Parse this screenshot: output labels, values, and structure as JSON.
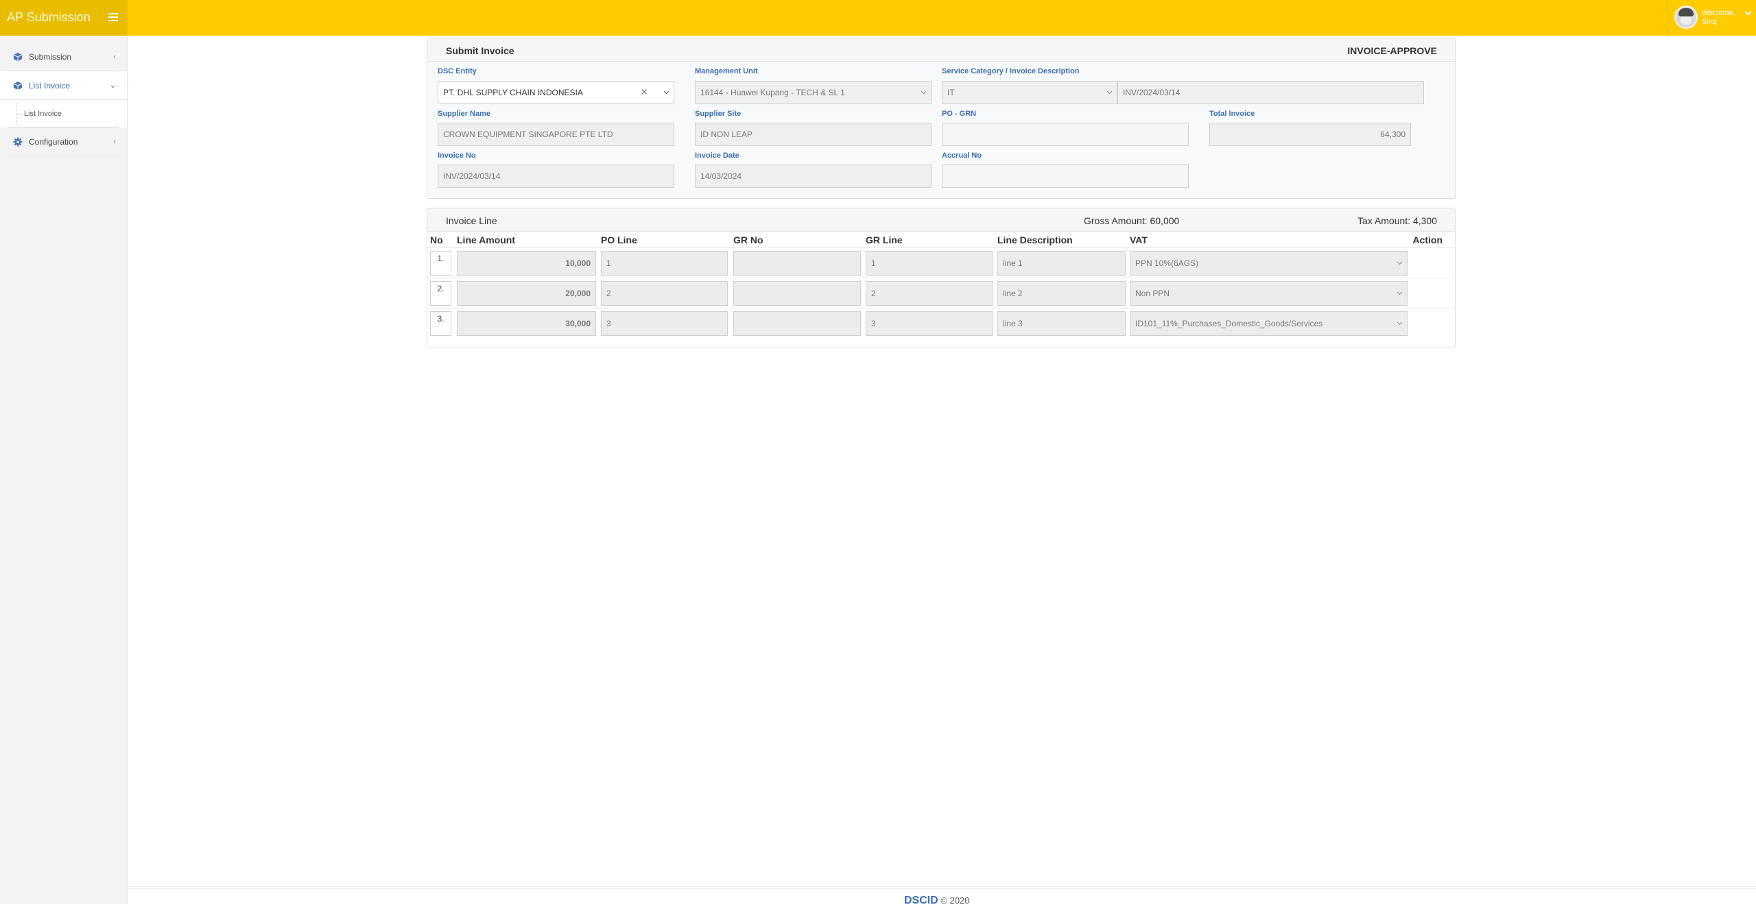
{
  "header": {
    "app_title": "AP Submission",
    "menu_icon": "hamburger-icon",
    "user": {
      "greeting": "Welcome,",
      "name": "Siroj",
      "avatar_icon": "user-avatar-icon",
      "caret_icon": "chevron-down-icon"
    }
  },
  "sidebar": {
    "items": [
      {
        "label": "Submission",
        "icon": "cube-icon",
        "caret": "‹",
        "active": false
      },
      {
        "label": "List Invoice",
        "icon": "cube-icon",
        "caret": "⌄",
        "active": true,
        "children": [
          {
            "label": "List Invoice"
          }
        ]
      },
      {
        "label": "Configuration",
        "icon": "gear-icon",
        "caret": "‹",
        "active": false
      }
    ]
  },
  "submit_panel": {
    "title": "Submit Invoice",
    "status": "INVOICE-APPROVE",
    "fields": {
      "dsc_entity": {
        "label": "DSC Entity",
        "value": "PT. DHL SUPPLY CHAIN INDONESIA",
        "clear_icon": "×"
      },
      "management_unit": {
        "label": "Management Unit",
        "value": "16144 - Huawei Kupang - TECH & SL 1"
      },
      "service_category": {
        "label": "Service Category / Invoice Description",
        "value": "IT",
        "description": "INV/2024/03/14"
      },
      "supplier_name": {
        "label": "Supplier Name",
        "value": "CROWN EQUIPMENT SINGAPORE PTE LTD"
      },
      "supplier_site": {
        "label": "Supplier Site",
        "value": "ID NON LEAP"
      },
      "po_grn": {
        "label": "PO - GRN",
        "value": ""
      },
      "total_invoice": {
        "label": "Total Invoice",
        "value": "64,300"
      },
      "invoice_no": {
        "label": "Invoice No",
        "value": "INV/2024/03/14"
      },
      "invoice_date": {
        "label": "Invoice Date",
        "value": "14/03/2024"
      },
      "accrual_no": {
        "label": "Accrual No",
        "value": ""
      }
    }
  },
  "invoice_line": {
    "title": "Invoice Line",
    "gross_amount": "Gross Amount: 60,000",
    "tax_amount": "Tax Amount: 4,300",
    "columns": [
      "No",
      "Line Amount",
      "PO Line",
      "GR No",
      "GR Line",
      "Line Description",
      "VAT",
      "Action"
    ],
    "rows": [
      {
        "no": "1.",
        "line_amount": "10,000",
        "po_line": "1",
        "gr_no": "",
        "gr_line": "1",
        "description": "line 1",
        "vat": "PPN 10%(6AGS)"
      },
      {
        "no": "2.",
        "line_amount": "20,000",
        "po_line": "2",
        "gr_no": "",
        "gr_line": "2",
        "description": "line 2",
        "vat": "Non PPN"
      },
      {
        "no": "3.",
        "line_amount": "30,000",
        "po_line": "3",
        "gr_no": "",
        "gr_line": "3",
        "description": "line 3",
        "vat": "ID101_11%_Purchases_Domestic_Goods/Services"
      }
    ]
  },
  "footer": {
    "brand": "DSCID",
    "copyright": "© 2020"
  }
}
